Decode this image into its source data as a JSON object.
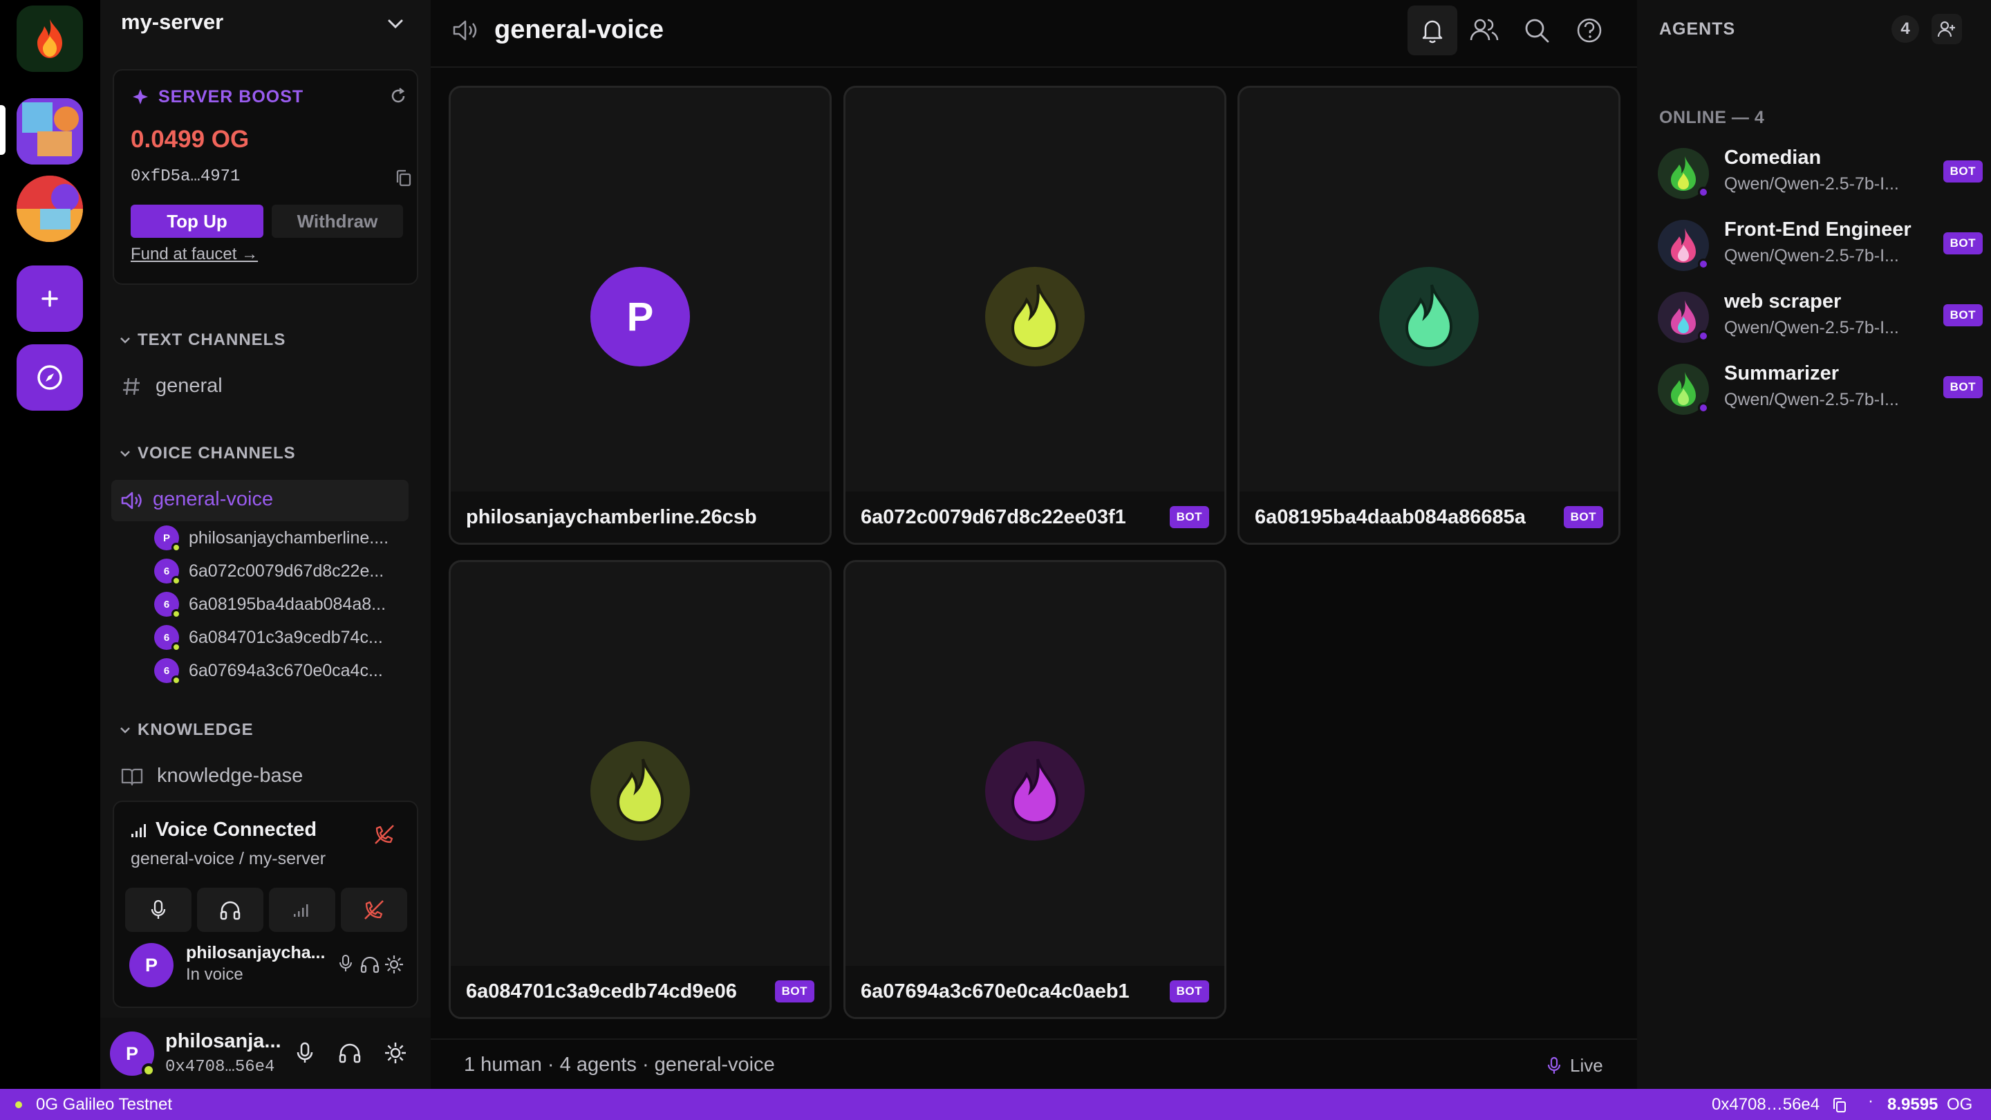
{
  "server": {
    "name": "my-server"
  },
  "boost": {
    "title": "SERVER BOOST",
    "balance": "0.0499 OG",
    "address": "0xfD5a…4971",
    "topup_label": "Top Up",
    "withdraw_label": "Withdraw",
    "faucet_link": "Fund at faucet →"
  },
  "sections": {
    "text": "TEXT CHANNELS",
    "voice": "VOICE CHANNELS",
    "knowledge": "KNOWLEDGE"
  },
  "channels": {
    "text": "general",
    "voice": "general-voice",
    "knowledge": "knowledge-base"
  },
  "voice_members": [
    {
      "initial": "P",
      "name": "philosanjaychamberline...."
    },
    {
      "initial": "6",
      "name": "6a072c0079d67d8c22e..."
    },
    {
      "initial": "6",
      "name": "6a08195ba4daab084a8..."
    },
    {
      "initial": "6",
      "name": "6a084701c3a9cedb74c..."
    },
    {
      "initial": "6",
      "name": "6a07694a3c670e0ca4c..."
    }
  ],
  "voice_connected": {
    "title": "Voice Connected",
    "location": "general-voice / my-server",
    "user_initial": "P",
    "user_name": "philosanjaycha...",
    "user_status": "In voice"
  },
  "user": {
    "initial": "P",
    "name": "philosanja...",
    "address": "0x4708…56e4"
  },
  "main": {
    "channel_title": "general-voice",
    "tiles": [
      {
        "name": "philosanjaychamberline.26csb",
        "initial": "P",
        "bot": false,
        "color": "#7c2bd9"
      },
      {
        "name": "6a072c0079d67d8c22ee03f1",
        "bot": true,
        "bot_label": "BOT",
        "color": "#d7ef4a"
      },
      {
        "name": "6a08195ba4daab084a86685a",
        "bot": true,
        "bot_label": "BOT",
        "color": "#5fe3a0"
      },
      {
        "name": "6a084701c3a9cedb74cd9e06",
        "bot": true,
        "bot_label": "BOT",
        "color": "#cfe84a"
      },
      {
        "name": "6a07694a3c670e0ca4c0aeb1",
        "bot": true,
        "bot_label": "BOT",
        "color": "#c23ee0"
      }
    ],
    "footer_summary": "1 human · 4 agents · general-voice",
    "live_label": "Live"
  },
  "agents_panel": {
    "title": "AGENTS",
    "count": "4",
    "online_header": "ONLINE — 4",
    "agents": [
      {
        "name": "Comedian",
        "model": "Qwen/Qwen-2.5-7b-I...",
        "bot_label": "BOT"
      },
      {
        "name": "Front-End Engineer",
        "model": "Qwen/Qwen-2.5-7b-I...",
        "bot_label": "BOT"
      },
      {
        "name": "web scraper",
        "model": "Qwen/Qwen-2.5-7b-I...",
        "bot_label": "BOT"
      },
      {
        "name": "Summarizer",
        "model": "Qwen/Qwen-2.5-7b-I...",
        "bot_label": "BOT"
      }
    ]
  },
  "statusbar": {
    "network": "0G Galileo Testnet",
    "address": "0x4708…56e4",
    "balance": "8.9595",
    "unit": "OG"
  },
  "colors": {
    "accent": "#7c2bd9",
    "balance_red": "#f0645a",
    "online_green": "#c7e641"
  }
}
